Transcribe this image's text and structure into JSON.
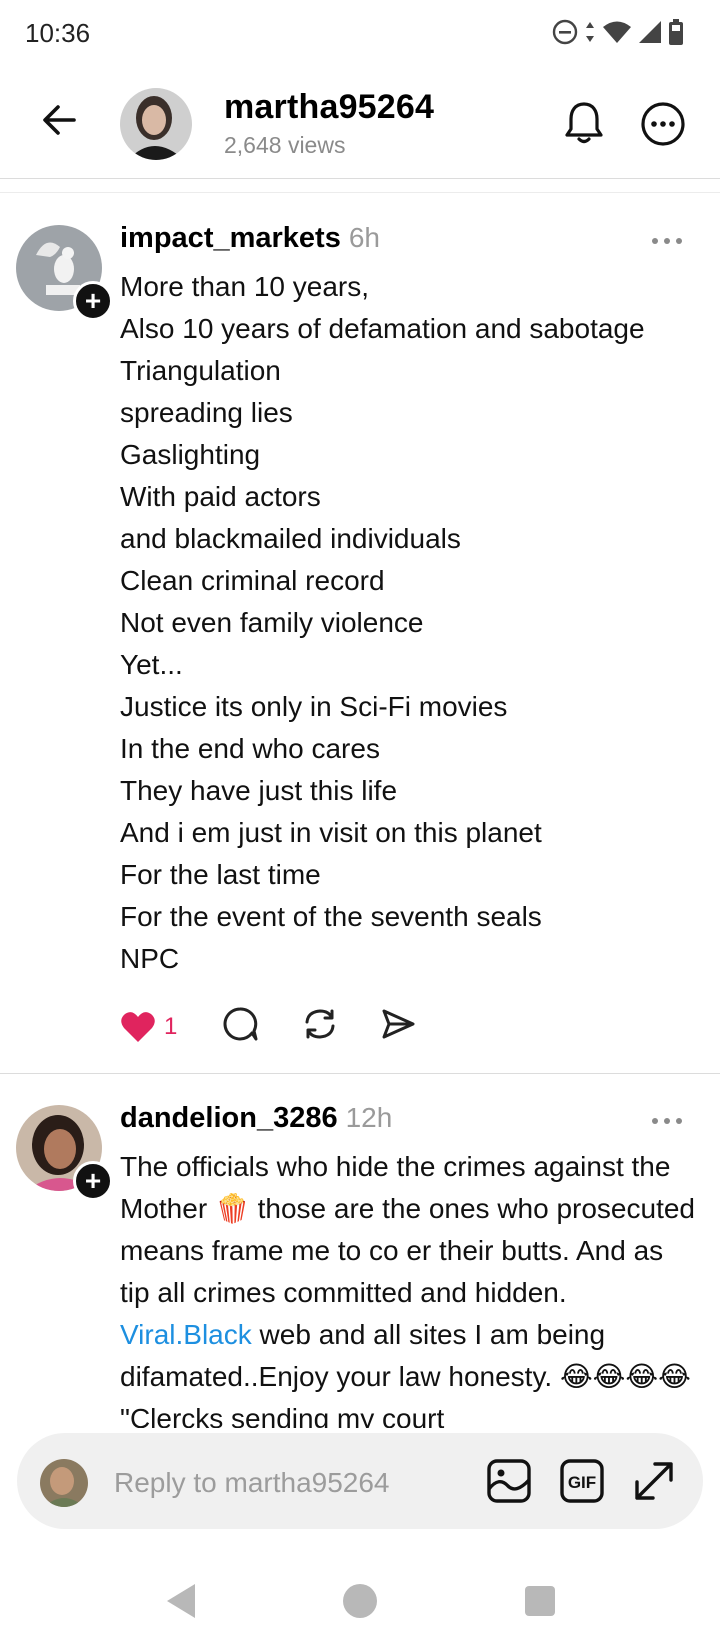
{
  "status_bar": {
    "time": "10:36"
  },
  "header": {
    "username": "martha95264",
    "views": "2,648 views"
  },
  "posts": [
    {
      "username": "impact_markets",
      "time": "6h",
      "lines": [
        "More than 10 years,",
        "Also 10 years  of defamation and sabotage",
        "Triangulation",
        "spreading lies",
        "Gaslighting",
        "With paid actors",
        "and blackmailed individuals",
        "Clean criminal record",
        "Not even family violence",
        "Yet...",
        "Justice its only in Sci-Fi movies",
        "In the end who cares",
        "They have just this life",
        "And i em just in visit on this planet",
        "For the last time",
        "For the event of the seventh seals",
        "NPC"
      ],
      "likes": "1"
    },
    {
      "username": "dandelion_3286",
      "time": "12h",
      "text_before_emoji": "The officials who hide the crimes against the Mother ",
      "emoji_1": "🍿",
      "text_after_emoji": " those are the ones who prosecuted means frame me to co er their butts. And as tip all crimes committed and hidden. ",
      "link": "Viral.Black",
      "text_after_link": " web and all sites I am being difamated..Enjoy your law honesty.",
      "emoji_2": "😂😂😂😂",
      "text_tail": " \"Clercks sending my court"
    }
  ],
  "reply": {
    "placeholder": "Reply to martha95264"
  },
  "colors": {
    "like_red": "#e0245e",
    "link_blue": "#1d8fe0"
  }
}
